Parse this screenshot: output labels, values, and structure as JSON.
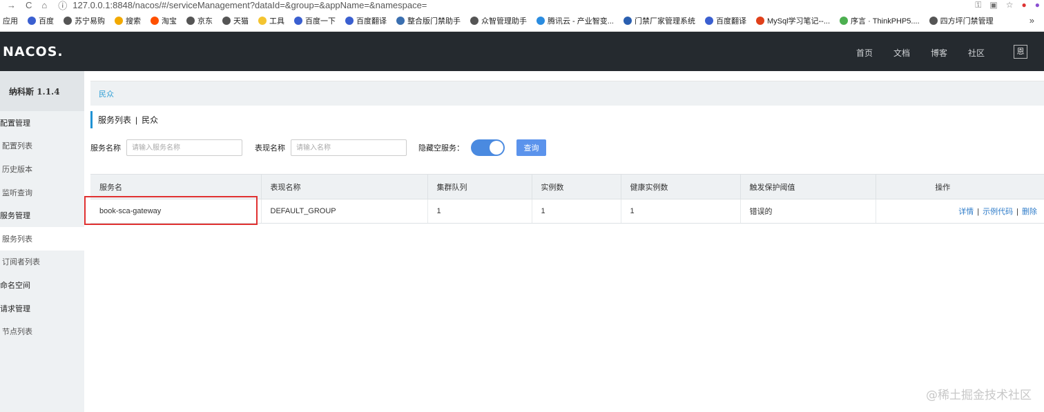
{
  "browser": {
    "url": "127.0.0.1:8848/nacos/#/serviceManagement?dataId=&group=&appName=&namespace=",
    "bookmarks": [
      {
        "label": "应用",
        "color": "#4a79d8"
      },
      {
        "label": "百度",
        "color": "#3a5fd0"
      },
      {
        "label": "苏宁易购",
        "color": "#555555"
      },
      {
        "label": "搜索",
        "color": "#f2a900"
      },
      {
        "label": "淘宝",
        "color": "#ff5000"
      },
      {
        "label": "京东",
        "color": "#555555"
      },
      {
        "label": "天猫",
        "color": "#555555"
      },
      {
        "label": "工具",
        "color": "#f4c430"
      },
      {
        "label": "百度一下",
        "color": "#3a5fd0"
      },
      {
        "label": "百度翻译",
        "color": "#3a5fd0"
      },
      {
        "label": "整合版门禁助手",
        "color": "#3a6fb0"
      },
      {
        "label": "众智管理助手",
        "color": "#555555"
      },
      {
        "label": "腾讯云 - 产业智变...",
        "color": "#2a8ce0"
      },
      {
        "label": "门禁厂家管理系统",
        "color": "#2a5fb0"
      },
      {
        "label": "百度翻译",
        "color": "#3a5fd0"
      },
      {
        "label": "MySql学习笔记--...",
        "color": "#e0401a"
      },
      {
        "label": "序言 · ThinkPHP5....",
        "color": "#4caf50"
      },
      {
        "label": "四方坪门禁管理",
        "color": "#555555"
      }
    ],
    "more": "»"
  },
  "header": {
    "logo": "NACOS.",
    "nav": [
      "首页",
      "文档",
      "博客",
      "社区"
    ],
    "lang": "恩"
  },
  "sidebar": {
    "title": "纳科斯 1.1.4",
    "items": [
      {
        "label": "配置管理",
        "type": "group"
      },
      {
        "label": "配置列表",
        "type": "sub"
      },
      {
        "label": "历史版本",
        "type": "sub"
      },
      {
        "label": "监听查询",
        "type": "sub"
      },
      {
        "label": "服务管理",
        "type": "group"
      },
      {
        "label": "服务列表",
        "type": "sub",
        "active": true
      },
      {
        "label": "订阅者列表",
        "type": "sub"
      },
      {
        "label": "命名空间",
        "type": "group"
      },
      {
        "label": "请求管理",
        "type": "group"
      },
      {
        "label": "节点列表",
        "type": "sub"
      }
    ]
  },
  "main": {
    "breadcrumb": "民众",
    "title": "服务列表",
    "title_sep": "|",
    "namespace": "民众",
    "filters": {
      "service_name_label": "服务名称",
      "service_name_placeholder": "请输入服务名称",
      "group_label": "表现名称",
      "group_placeholder": "请输入名称",
      "hide_empty_label": "隐藏空服务：",
      "hide_empty_on": true,
      "query_label": "查询"
    },
    "table": {
      "columns": [
        "服务名",
        "表现名称",
        "集群队列",
        "实例数",
        "健康实例数",
        "触发保护阈值",
        "操作"
      ],
      "rows": [
        {
          "service": "book-sca-gateway",
          "group": "DEFAULT_GROUP",
          "clusters": "1",
          "instances": "1",
          "healthy": "1",
          "threshold": "错误的",
          "ops": [
            "详情",
            "示例代码",
            "删除"
          ]
        }
      ]
    }
  },
  "watermark": "@稀土掘金技术社区"
}
